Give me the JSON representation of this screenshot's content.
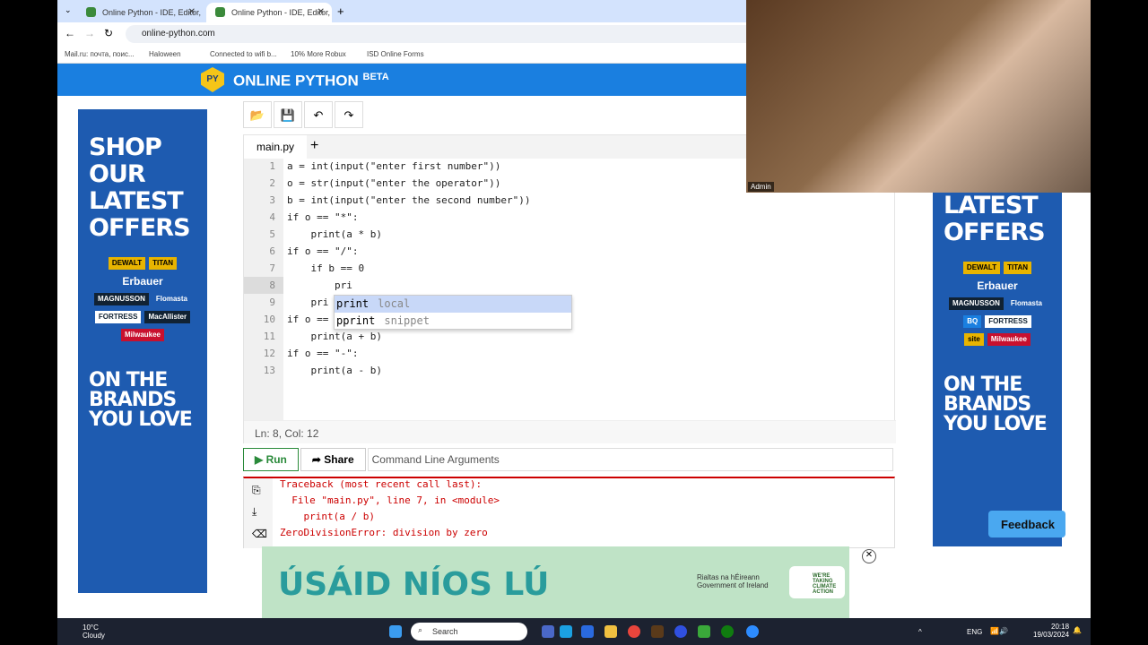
{
  "browser": {
    "tabs": [
      {
        "title": "Online Python - IDE, Editor, Co"
      },
      {
        "title": "Online Python - IDE, Editor, Co"
      }
    ],
    "new_tab": "+",
    "url": "online-python.com",
    "bookmarks": [
      "Mail.ru: почта, поис...",
      "Haloween",
      "Connected to wifi b...",
      "10% More Robux",
      "ISD Online Forms"
    ]
  },
  "site": {
    "logo": "PY",
    "brand": "ONLINE PYTHON",
    "badge": "BETA"
  },
  "ads": {
    "left": {
      "headline": "SHOP OUR LATEST OFFERS",
      "brands": [
        "DEWALT",
        "TITAN",
        "Erbauer",
        "MAGNUSSON",
        "Flomasta",
        "FORTRESS",
        "MacAllister",
        "Milwaukee"
      ],
      "footer": "ON THE BRANDS YOU LOVE"
    },
    "right": {
      "headline": "LATEST OFFERS",
      "brands": [
        "DEWALT",
        "TITAN",
        "Erbauer",
        "MAGNUSSON",
        "Flomasta",
        "BQ",
        "FORTRESS",
        "site",
        "Milwaukee"
      ],
      "footer": "ON THE BRANDS YOU LOVE"
    },
    "bottom": {
      "headline": "ÚSÁID NÍOS LÚ",
      "sponsor": "Rialtas na hÉireann Government of Ireland",
      "badge": "WE'RE TAKING CLIMATE ACTION"
    }
  },
  "toolbar": {
    "icons": [
      "folder-open-icon",
      "save-icon",
      "undo-icon",
      "redo-icon"
    ]
  },
  "editor": {
    "tab": "main.py",
    "add_tab": "+",
    "lines": [
      "a = int(input(\"enter first number\"))",
      "o = str(input(\"enter the operator\"))",
      "b = int(input(\"enter the second number\"))",
      "if o == \"*\":",
      "    print(a * b)",
      "if o == \"/\":",
      "    if b == 0",
      "        pri",
      "    pri",
      "if o == ",
      "    print(a + b)",
      "if o == \"-\":",
      "    print(a - b)"
    ],
    "line_numbers": [
      "1",
      "2",
      "3",
      "4",
      "5",
      "6",
      "7",
      "8",
      "9",
      "10",
      "11",
      "12",
      "13"
    ],
    "autocomplete": [
      {
        "name": "print",
        "meta": "local"
      },
      {
        "name": "pprint",
        "meta": "snippet"
      }
    ],
    "status": "Ln: 8, Col: 12"
  },
  "run": {
    "run_label": "Run",
    "share_label": "Share",
    "args_placeholder": "Command Line Arguments"
  },
  "console": {
    "output": [
      "Traceback (most recent call last):",
      "  File \"main.py\", line 7, in <module>",
      "    print(a / b)",
      "ZeroDivisionError: division by zero"
    ]
  },
  "feedback": "Feedback",
  "webcam": {
    "label": "Admin"
  },
  "taskbar": {
    "weather_temp": "10°C",
    "weather_desc": "Cloudy",
    "search": "Search",
    "lang": "ENG",
    "time": "20:18",
    "date": "19/03/2024"
  }
}
